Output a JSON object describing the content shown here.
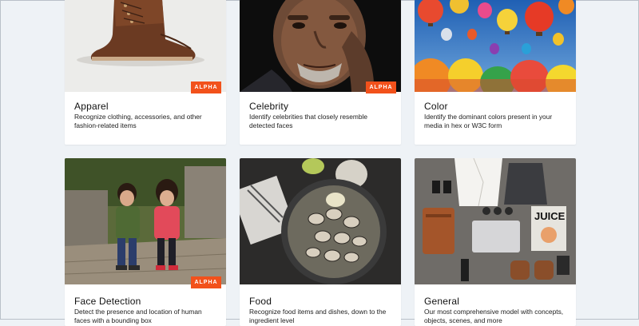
{
  "models": [
    {
      "name": "Apparel",
      "description": "Recognize clothing, accessories, and other fashion-related items",
      "badge": "ALPHA",
      "image": "leather-boot-photo"
    },
    {
      "name": "Celebrity",
      "description": "Identify celebrities that closely resemble detected faces",
      "badge": "ALPHA",
      "image": "celebrity-portrait-photo"
    },
    {
      "name": "Color",
      "description": "Identify the dominant colors present in your media in hex or W3C form",
      "badge": "",
      "image": "hot-air-balloons-photo"
    },
    {
      "name": "Face Detection",
      "description": "Detect the presence and location of human faces with a bounding box",
      "badge": "ALPHA",
      "image": "two-children-photo"
    },
    {
      "name": "Food",
      "description": "Recognize food items and dishes, down to the ingredient level",
      "badge": "",
      "image": "clams-in-pan-photo"
    },
    {
      "name": "General",
      "description": "Our most comprehensive model with concepts, objects, scenes, and more",
      "badge": "",
      "image": "flat-lay-travel-items-photo",
      "image_text": "JUICE"
    }
  ],
  "colors": {
    "background": "#eef2f6",
    "card": "#ffffff",
    "badge": "#f2511b"
  }
}
